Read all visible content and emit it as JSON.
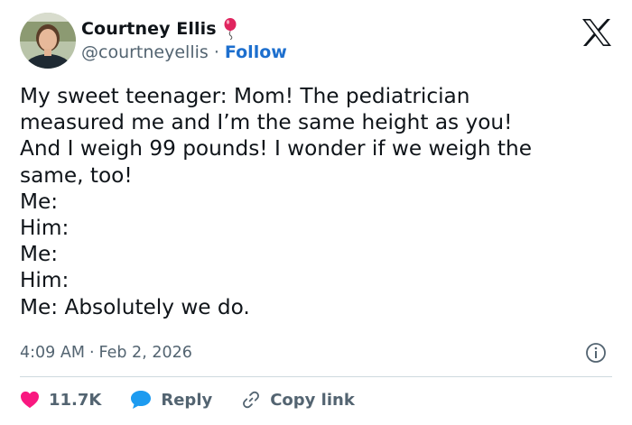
{
  "user": {
    "display_name": "Courtney Ellis",
    "handle": "@courtneyellis",
    "separator": "·",
    "follow_label": "Follow"
  },
  "tweet": {
    "lines": [
      "My sweet teenager: Mom! The pediatrician",
      "measured me and I’m the same height as you!",
      "And I weigh 99 pounds! I wonder if we weigh the",
      "same, too!",
      "Me:",
      "Him:",
      "Me:",
      "Him:",
      "Me: Absolutely we do."
    ]
  },
  "meta": {
    "time": "4:09 AM",
    "separator": "·",
    "date": "Feb 2, 2026"
  },
  "actions": {
    "likes": "11.7K",
    "reply_label": "Reply",
    "copy_link_label": "Copy link"
  },
  "colors": {
    "heart": "#f91880",
    "reply_bubble": "#1d9bf0",
    "link": "#1d6fce",
    "muted": "#536471"
  },
  "icons": [
    "balloon-icon",
    "x-logo-icon",
    "info-icon",
    "heart-icon",
    "reply-icon",
    "link-icon"
  ]
}
